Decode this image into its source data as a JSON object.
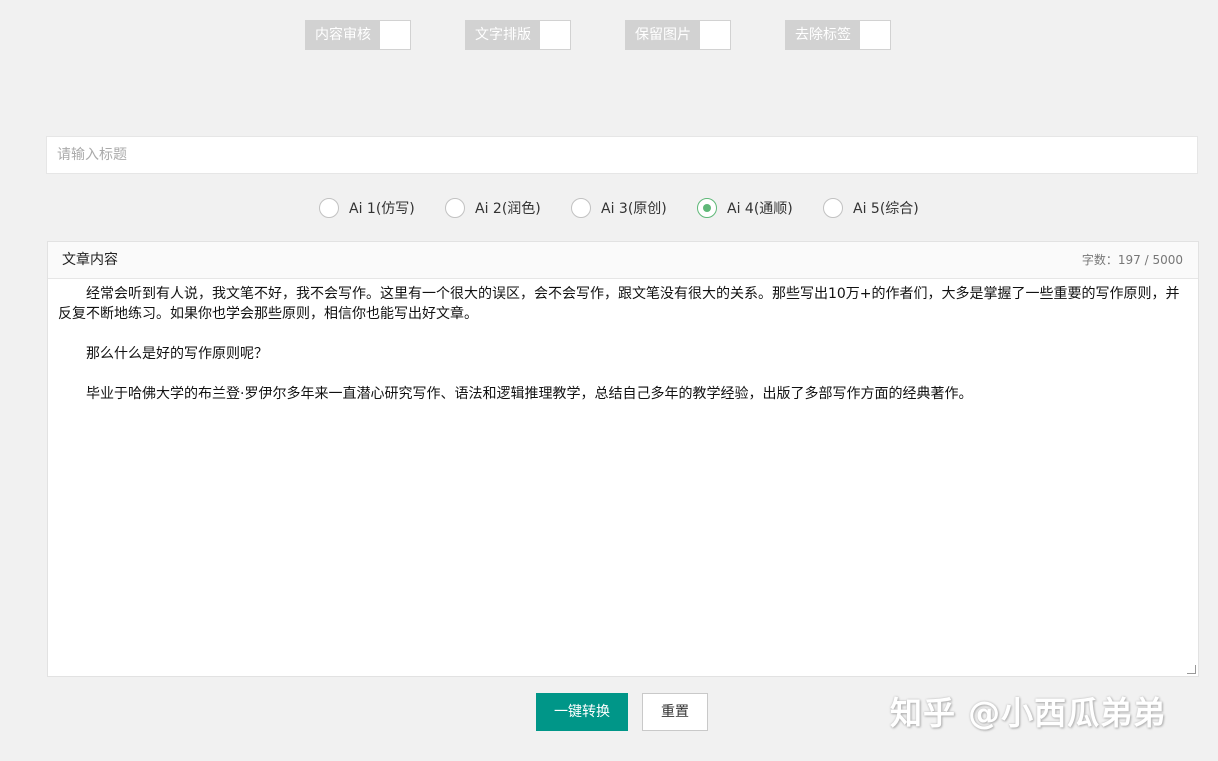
{
  "toggles": [
    {
      "label": "内容审核"
    },
    {
      "label": "文字排版"
    },
    {
      "label": "保留图片"
    },
    {
      "label": "去除标签"
    }
  ],
  "title_input": {
    "placeholder": "请输入标题",
    "value": ""
  },
  "modes": [
    {
      "label": "Ai 1(仿写)",
      "checked": false
    },
    {
      "label": "Ai 2(润色)",
      "checked": false
    },
    {
      "label": "Ai 3(原创)",
      "checked": false
    },
    {
      "label": "Ai 4(通顺)",
      "checked": true
    },
    {
      "label": "Ai 5(综合)",
      "checked": false
    }
  ],
  "editor": {
    "title": "文章内容",
    "word_count": "字数：197 / 5000",
    "paragraphs": [
      "经常会听到有人说，我文笔不好，我不会写作。这里有一个很大的误区，会不会写作，跟文笔没有很大的关系。那些写出10万+的作者们，大多是掌握了一些重要的写作原则，并反复不断地练习。如果你也学会那些原则，相信你也能写出好文章。",
      "那么什么是好的写作原则呢？",
      "毕业于哈佛大学的布兰登·罗伊尔多年来一直潜心研究写作、语法和逻辑推理教学，总结自己多年的教学经验，出版了多部写作方面的经典著作。"
    ]
  },
  "buttons": {
    "convert": "一键转换",
    "reset": "重置"
  },
  "watermark": "知乎 @小西瓜弟弟",
  "colors": {
    "accent": "#009688",
    "radio_checked": "#5fb878",
    "toggle_off": "#d2d2d2"
  }
}
